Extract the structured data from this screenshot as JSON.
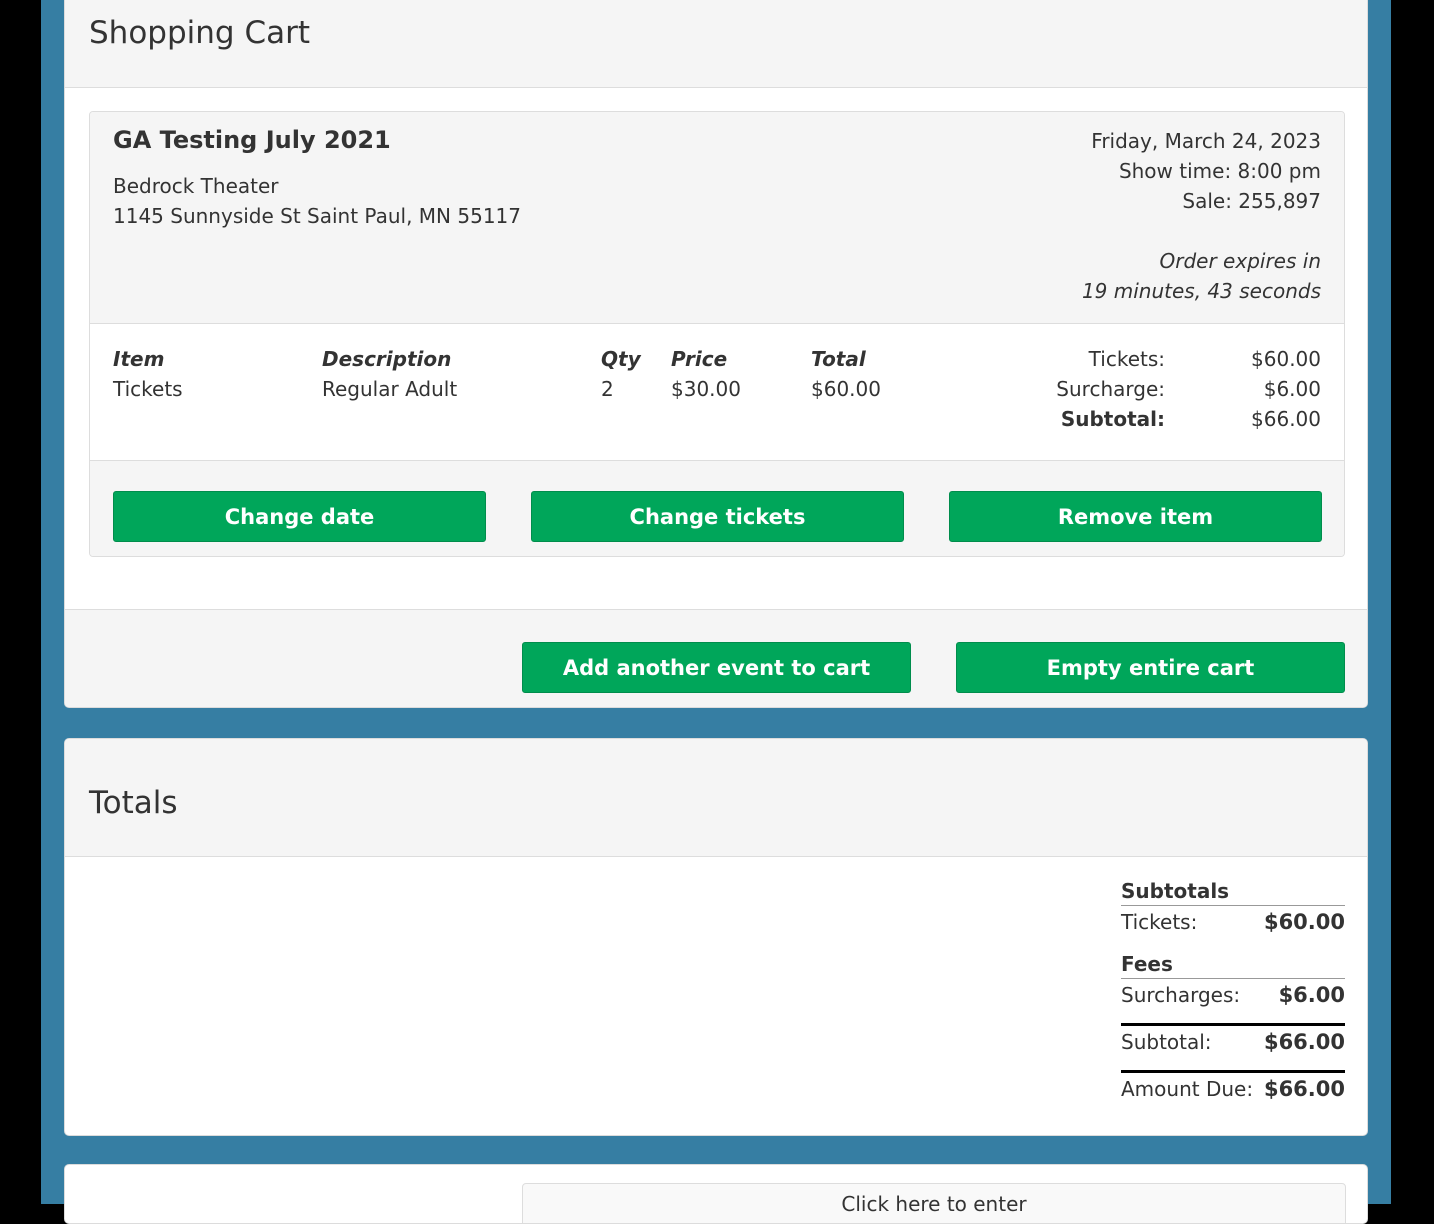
{
  "cart": {
    "title": "Shopping Cart",
    "event": {
      "title": "GA Testing July 2021",
      "venue_name": "Bedrock Theater",
      "venue_address": "1145 Sunnyside St Saint Paul, MN 55117",
      "date": "Friday, March 24, 2023",
      "show_time": "Show time: 8:00 pm",
      "sale": "Sale: 255,897",
      "expires_line1": "Order expires in",
      "expires_line2": "19 minutes, 43 seconds"
    },
    "table": {
      "headers": {
        "item": "Item",
        "description": "Description",
        "qty": "Qty",
        "price": "Price",
        "total": "Total"
      },
      "rows": [
        {
          "item": "Tickets",
          "description": "Regular Adult",
          "qty": "2",
          "price": "$30.00",
          "total": "$60.00"
        }
      ]
    },
    "summary": {
      "tickets_label": "Tickets:",
      "tickets_value": "$60.00",
      "surcharge_label": "Surcharge:",
      "surcharge_value": "$6.00",
      "subtotal_label": "Subtotal:",
      "subtotal_value": "$66.00"
    },
    "buttons": {
      "change_date": "Change date",
      "change_tickets": "Change tickets",
      "remove_item": "Remove item",
      "add_event": "Add another event to cart",
      "empty_cart": "Empty entire cart"
    }
  },
  "totals": {
    "title": "Totals",
    "subtotals_heading": "Subtotals",
    "tickets_label": "Tickets:",
    "tickets_value": "$60.00",
    "fees_heading": "Fees",
    "surcharges_label": "Surcharges:",
    "surcharges_value": "$6.00",
    "subtotal_label": "Subtotal:",
    "subtotal_value": "$66.00",
    "amount_due_label": "Amount Due:",
    "amount_due_value": "$66.00"
  },
  "bottom": {
    "click_here": "Click here to enter"
  },
  "colors": {
    "background": "#367ea3",
    "button": "#00a65a"
  }
}
